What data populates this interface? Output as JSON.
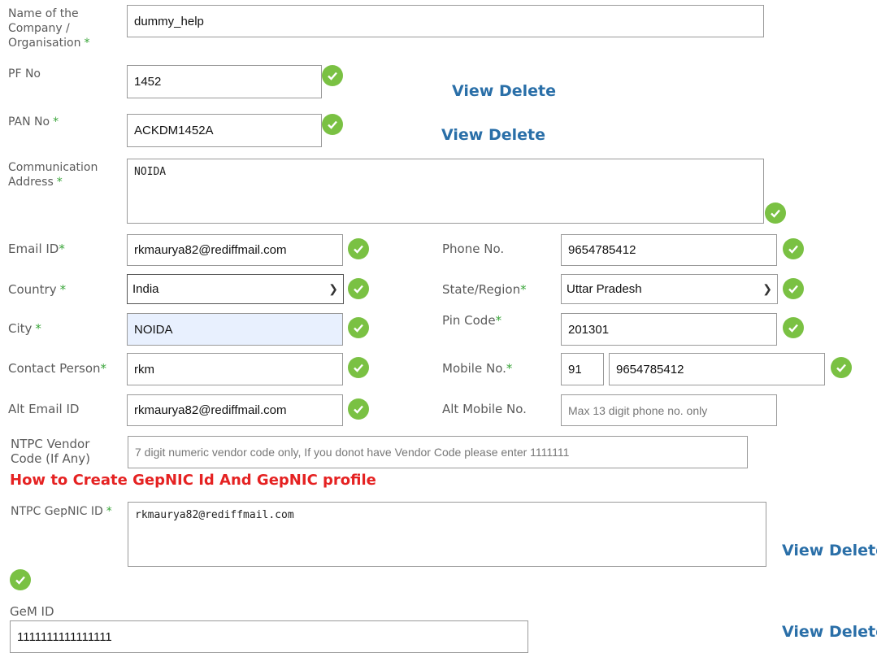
{
  "company": {
    "label": "Name of the Company / Organisation",
    "value": "dummy_help"
  },
  "pf": {
    "label": "PF No",
    "value": "1452",
    "view": "View",
    "delete": "Delete"
  },
  "pan": {
    "label": "PAN No",
    "value": "ACKDM1452A",
    "view": "View",
    "delete": "Delete"
  },
  "address": {
    "label": "Communication Address",
    "value": "NOIDA"
  },
  "email": {
    "label": "Email ID",
    "value": "rkmaurya82@rediffmail.com"
  },
  "phone": {
    "label": "Phone No.",
    "value": "9654785412"
  },
  "country": {
    "label": "Country",
    "value": "India"
  },
  "state": {
    "label": "State/Region",
    "value": "Uttar Pradesh"
  },
  "city": {
    "label": "City",
    "value": "NOIDA"
  },
  "pin": {
    "label": "Pin Code",
    "value": "201301"
  },
  "contact": {
    "label": "Contact Person",
    "value": "rkm"
  },
  "mobile": {
    "label": "Mobile No.",
    "code": "91",
    "value": "9654785412"
  },
  "alt_email": {
    "label": "Alt Email ID",
    "value": "rkmaurya82@rediffmail.com"
  },
  "alt_mobile": {
    "label": "Alt Mobile No.",
    "placeholder": "Max 13 digit phone no. only"
  },
  "vendor": {
    "label": "NTPC Vendor Code (If Any)",
    "placeholder": "7 digit numeric vendor code only, If you donot have Vendor Code please enter 1111111"
  },
  "gepnic_link": "How to Create GepNIC Id And GepNIC profile",
  "gepnic": {
    "label": "NTPC GepNIC ID",
    "value": "rkmaurya82@rediffmail.com",
    "view": "View",
    "delete": "Delete"
  },
  "gem": {
    "label": "GeM ID",
    "value": "1111111111111111",
    "view": "View",
    "delete": "Delete"
  },
  "required_mark": "*",
  "colors": {
    "check": "#7ac143",
    "link": "#2a6fa8",
    "required": "#3aa53a",
    "alert": "#e52222"
  },
  "icons": {
    "check": "check-circle-icon",
    "dropdown": "chevron-down-icon"
  }
}
